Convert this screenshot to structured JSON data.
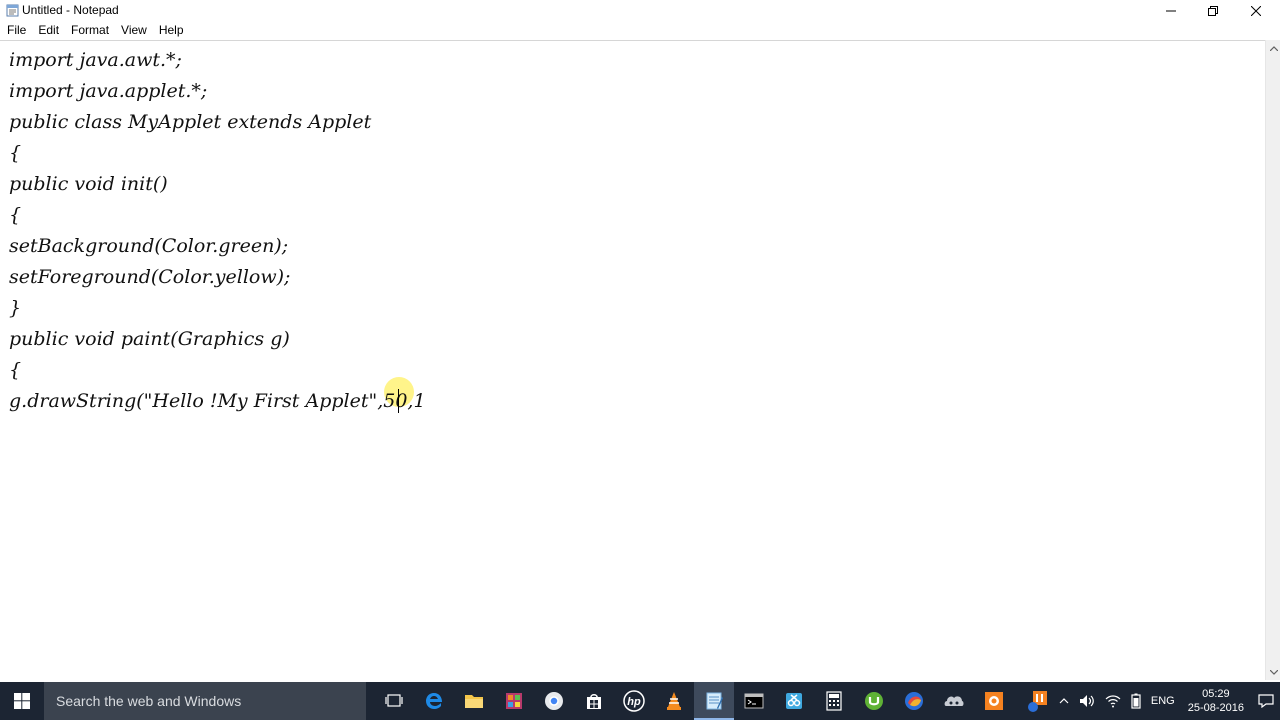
{
  "window": {
    "title": "Untitled - Notepad"
  },
  "menu": [
    "File",
    "Edit",
    "Format",
    "View",
    "Help"
  ],
  "editor": {
    "lines": [
      "import java.awt.*;",
      "import java.applet.*;",
      "public class MyApplet extends Applet",
      "{",
      "public void init()",
      "{",
      "setBackground(Color.green);",
      "setForeground(Color.yellow);",
      "}",
      "public void paint(Graphics g)",
      "{",
      "g.drawString(\"Hello !My First Applet\",50,1"
    ]
  },
  "taskbar": {
    "search_placeholder": "Search the web and Windows",
    "language": "ENG",
    "time": "05:29",
    "date": "25-08-2016",
    "apps": [
      "task-view-icon",
      "edge-icon",
      "file-explorer-icon",
      "app-grid-icon",
      "chrome-icon",
      "store-icon",
      "hp-icon",
      "vlc-icon",
      "notepad-icon",
      "cmd-icon",
      "snip-icon",
      "calculator-icon",
      "utorrent-icon",
      "browser-icon",
      "settings-icon",
      "media-icon"
    ]
  },
  "colors": {
    "taskbar_bg": "#1c2533",
    "search_bg": "#3b434f",
    "cursor_highlight": "#ffec3c"
  }
}
